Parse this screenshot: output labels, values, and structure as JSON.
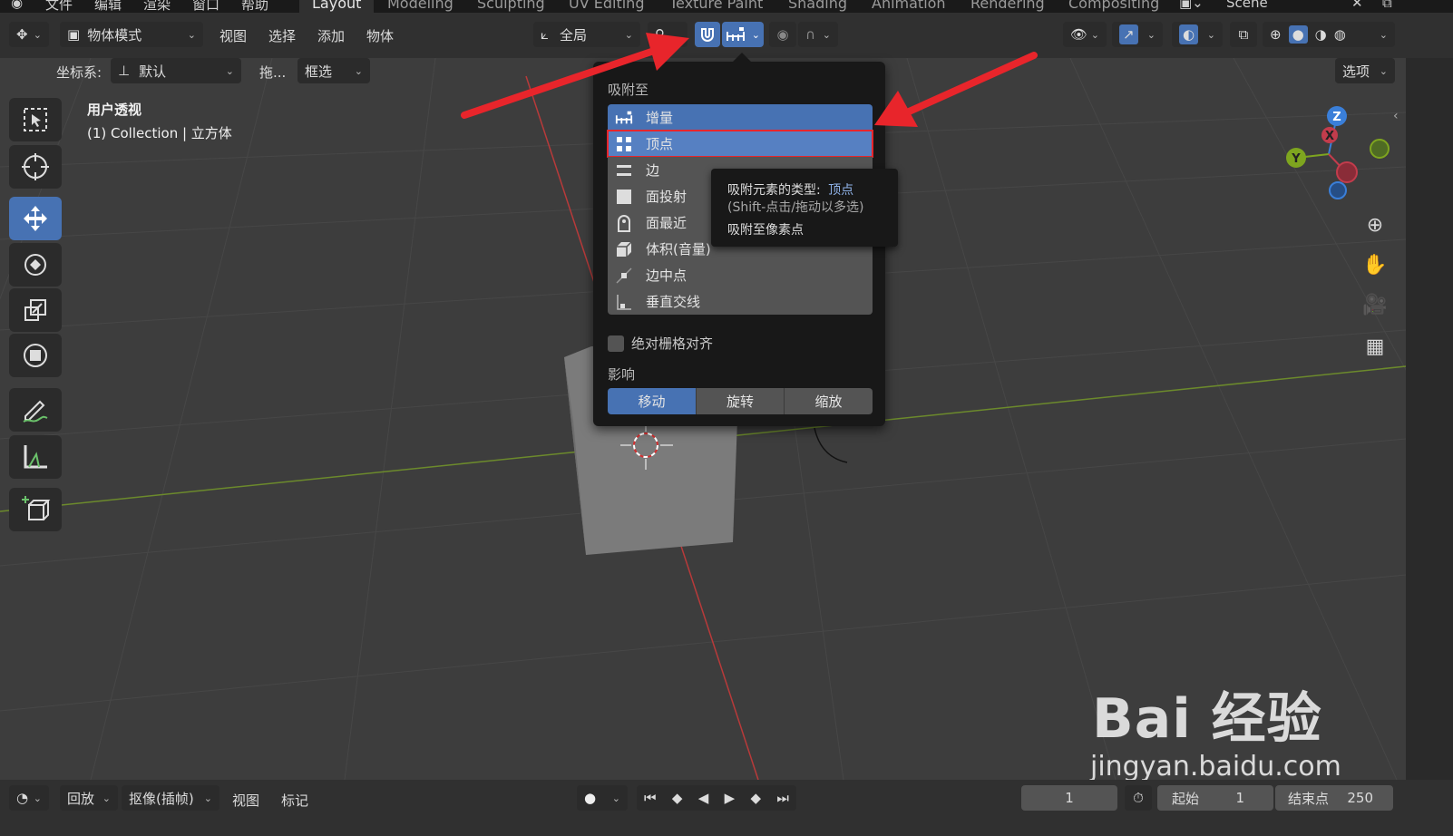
{
  "menu": {
    "file": "文件",
    "edit": "编辑",
    "render": "渲染",
    "window": "窗口",
    "help": "帮助"
  },
  "workspaces": [
    "Layout",
    "Modeling",
    "Sculpting",
    "UV Editing",
    "Texture Paint",
    "Shading",
    "Animation",
    "Rendering",
    "Compositing"
  ],
  "scene": "Scene",
  "header": {
    "mode": "物体模式",
    "view": "视图",
    "select": "选择",
    "add": "添加",
    "object": "物体",
    "transform_orientation": "全局",
    "coord_label": "坐标系:",
    "coord_value": "默认",
    "drag_label": "拖...",
    "drag_value": "框选",
    "options": "选项"
  },
  "viewport": {
    "view_name": "用户透视",
    "collection": "(1) Collection | 立方体",
    "gizmo": {
      "z": "Z",
      "x": "X",
      "y": "Y"
    }
  },
  "snap_popup": {
    "title": "吸附至",
    "options": [
      {
        "label": "增量",
        "icon": "increment-icon"
      },
      {
        "label": "顶点",
        "icon": "vertex-icon"
      },
      {
        "label": "边",
        "icon": "edge-icon"
      },
      {
        "label": "面投射",
        "icon": "face-project-icon"
      },
      {
        "label": "面最近",
        "icon": "face-nearest-icon"
      },
      {
        "label": "体积(音量)",
        "icon": "volume-icon"
      },
      {
        "label": "边中点",
        "icon": "edge-center-icon"
      },
      {
        "label": "垂直交线",
        "icon": "perpendicular-icon"
      }
    ],
    "absolute_grid": "绝对栅格对齐",
    "affect_title": "影响",
    "affect": [
      "移动",
      "旋转",
      "缩放"
    ]
  },
  "tooltip": {
    "line1_prefix": "吸附元素的类型:",
    "line1_value": "顶点",
    "line2": "(Shift-点击/拖动以多选)",
    "line3": "吸附至像素点"
  },
  "timeline": {
    "playback": "回放",
    "keying": "抠像(插帧)",
    "view": "视图",
    "marker": "标记",
    "current_frame": "1",
    "start_label": "起始",
    "start_value": "1",
    "end_label": "结束点",
    "end_value": "250"
  },
  "watermark": {
    "brand": "Bai  经验",
    "url": "jingyan.baidu.com"
  },
  "colors": {
    "accent": "#4772b3",
    "arrow": "#e8252b",
    "x_axis": "#c33c4c",
    "y_axis": "#7ea51f",
    "z_axis": "#3a7fd9"
  }
}
